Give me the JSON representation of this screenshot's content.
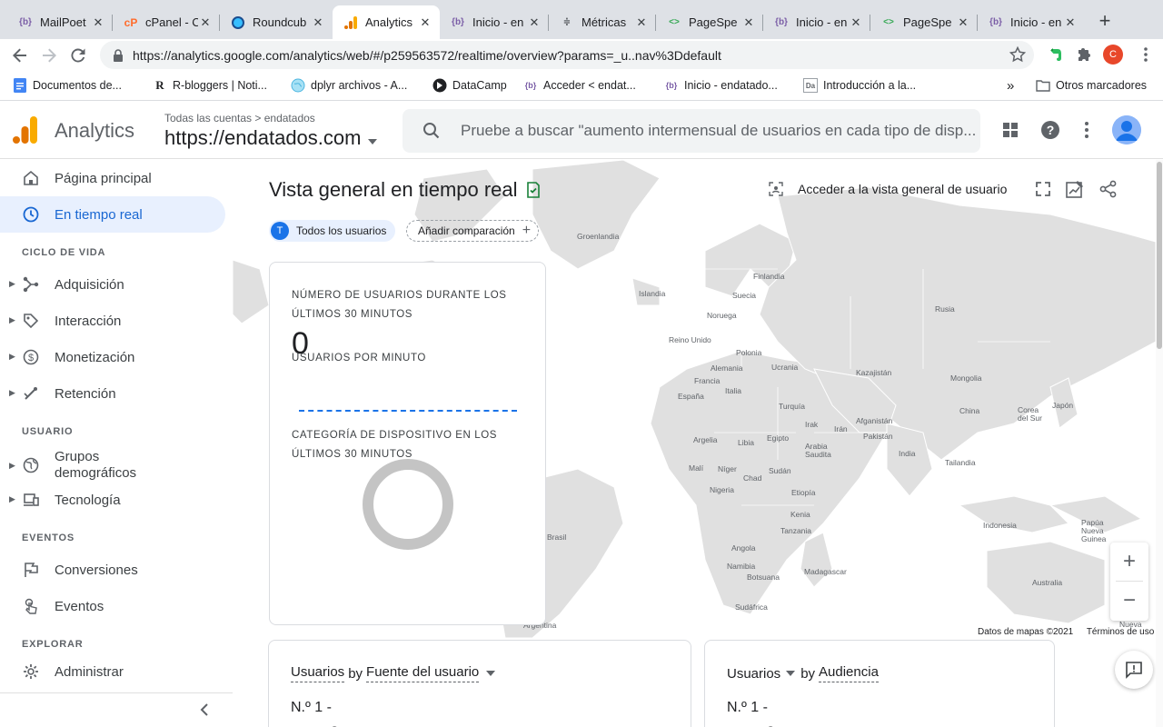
{
  "browser": {
    "tabs": [
      {
        "label": "MailPoet",
        "icon": "wordpress-icon"
      },
      {
        "label": "cPanel - C",
        "icon": "cpanel-icon"
      },
      {
        "label": "Roundcub",
        "icon": "roundcube-icon"
      },
      {
        "label": "Analytics",
        "icon": "analytics-icon",
        "active": true
      },
      {
        "label": "Inicio - en",
        "icon": "wordpress-icon"
      },
      {
        "label": "Métricas",
        "icon": "metrics-icon"
      },
      {
        "label": "PageSpe",
        "icon": "pagespeed-icon"
      },
      {
        "label": "Inicio - en",
        "icon": "wordpress-icon"
      },
      {
        "label": "PageSpe",
        "icon": "pagespeed-icon"
      },
      {
        "label": "Inicio - en",
        "icon": "wordpress-icon"
      }
    ],
    "url": "https://analytics.google.com/analytics/web/#/p259563572/realtime/overview?params=_u..nav%3Ddefault",
    "profile_initial": "C",
    "bookmarks": [
      {
        "label": "Documentos de...",
        "icon": "docs-icon"
      },
      {
        "label": "R-bloggers | Noti...",
        "icon": "rbloggers-icon"
      },
      {
        "label": "dplyr archivos - A...",
        "icon": "globe-icon"
      },
      {
        "label": "DataCamp",
        "icon": "datacamp-icon"
      },
      {
        "label": "Acceder < endat...",
        "icon": "wordpress-icon"
      },
      {
        "label": "Inicio - endatado...",
        "icon": "wordpress-icon"
      },
      {
        "label": "Introducción a la...",
        "icon": "doc-icon"
      }
    ],
    "bookmarks_more": "»",
    "other_bookmarks": "Otros marcadores"
  },
  "ga": {
    "app_name": "Analytics",
    "breadcrumb": "Todas las cuentas > endatados",
    "property": "https://endatados.com",
    "search_placeholder": "Pruebe a buscar \"aumento intermensual de usuarios en cada tipo de disp..."
  },
  "sidebar": {
    "home": "Página principal",
    "realtime": "En tiempo real",
    "sections": {
      "lifecycle": "CICLO DE VIDA",
      "user": "USUARIO",
      "events": "EVENTOS",
      "explore": "EXPLORAR"
    },
    "acquisition": "Adquisición",
    "engagement": "Interacción",
    "monetization": "Monetización",
    "retention": "Retención",
    "demographics": "Grupos demográficos",
    "tech": "Tecnología",
    "conversions": "Conversiones",
    "events": "Eventos",
    "admin": "Administrar"
  },
  "main": {
    "title": "Vista general en tiempo real",
    "user_overview": "Acceder a la vista general de usuario",
    "chip_all_initial": "T",
    "chip_all": "Todos los usuarios",
    "chip_add": "Añadir comparación",
    "card": {
      "users_heading": "NÚMERO DE USUARIOS DURANTE LOS ÚLTIMOS 30 MINUTOS",
      "users_value": "0",
      "per_minute": "USUARIOS POR MINUTO",
      "device_heading": "CATEGORÍA DE DISPOSITIVO EN LOS ÚLTIMOS 30 MINUTOS"
    },
    "map_credit": "Datos de mapas ©2021",
    "map_terms": "Términos de uso",
    "map_labels": {
      "groenlandia": "Groenlandia",
      "islandia": "Islandia",
      "finlandia": "Finlandia",
      "suecia": "Suecia",
      "noruega": "Noruega",
      "rusia": "Rusia",
      "reino_unido": "Reino Unido",
      "polonia": "Polonia",
      "alemania": "Alemania",
      "ucrania": "Ucrania",
      "francia": "Francia",
      "italia": "Italia",
      "kazajistan": "Kazajistán",
      "mongolia": "Mongolia",
      "espana": "España",
      "turquia": "Turquía",
      "china": "China",
      "corea": "Corea del Sur",
      "japon": "Japón",
      "afganistan": "Afganistán",
      "irak": "Irak",
      "iran": "Irán",
      "pakistan": "Pakistán",
      "argelia": "Argelia",
      "libia": "Libia",
      "egipto": "Egipto",
      "arabia": "Arabia Saudita",
      "india": "India",
      "tailandia": "Tailandia",
      "mali": "Malí",
      "niger": "Níger",
      "chad": "Chad",
      "sudan": "Sudán",
      "nigeria": "Nigeria",
      "etiopia": "Etiopía",
      "kenia": "Kenia",
      "tanzania": "Tanzania",
      "indonesia": "Indonesia",
      "papua": "Papúa Nueva Guinea",
      "brasil": "Brasil",
      "angola": "Angola",
      "namibia": "Namibia",
      "botsuana": "Botsuana",
      "madagascar": "Madagascar",
      "australia": "Australia",
      "sudafrica": "Sudáfrica",
      "argentina": "Argentina",
      "nueva": "Nueva"
    },
    "card_source": {
      "metric": "Usuarios",
      "by": "by",
      "dimension": "Fuente del usuario",
      "rank": "N.º 1  -"
    },
    "card_audience": {
      "metric": "Usuarios",
      "by": "by",
      "dimension": "Audiencia",
      "rank": "N.º 1  -"
    },
    "ghost_glyph": "0"
  },
  "colors": {
    "brand_orange": "#f9ab00",
    "brand_orange_dark": "#e37400",
    "accent_blue": "#1a73e8",
    "active_bg": "#e8f0fe",
    "map_land": "#e0e0e0",
    "donut": "#c4c4c4"
  }
}
